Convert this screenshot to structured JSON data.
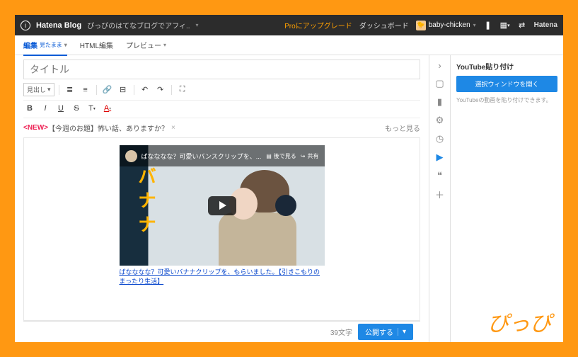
{
  "topbar": {
    "logo": "Hatena Blog",
    "subtitle": "ぴっぴのはてなブログでアフィ..",
    "pro": "Proにアップグレード",
    "dashboard": "ダッシュボード",
    "username": "baby-chicken",
    "brand": "Hatena"
  },
  "tabs": {
    "edit": "編集",
    "edit_mode": "見たまま",
    "html": "HTML編集",
    "preview": "プレビュー"
  },
  "title_placeholder": "タイトル",
  "toolbar": {
    "heading_sel": "見出し"
  },
  "topic": {
    "new": "<NEW>",
    "label": "【今週のお題】怖い話、ありますか？",
    "more": "もっと見る"
  },
  "video": {
    "title": "ばなななな？可愛いバンスクリップを、...",
    "watch_later": "後で見る",
    "share": "共有",
    "banana": "バナナ",
    "caption": "ばなななな？可愛いバナナクリップを、もらいました。【引きこもりのまったり生活】"
  },
  "footer": {
    "count": "39文字",
    "publish": "公開する"
  },
  "panel": {
    "title": "YouTube貼り付け",
    "button": "選択ウィンドウを開く",
    "hint": "YouTubeの動画を貼り付けできます。"
  },
  "watermark": "ぴっぴ"
}
